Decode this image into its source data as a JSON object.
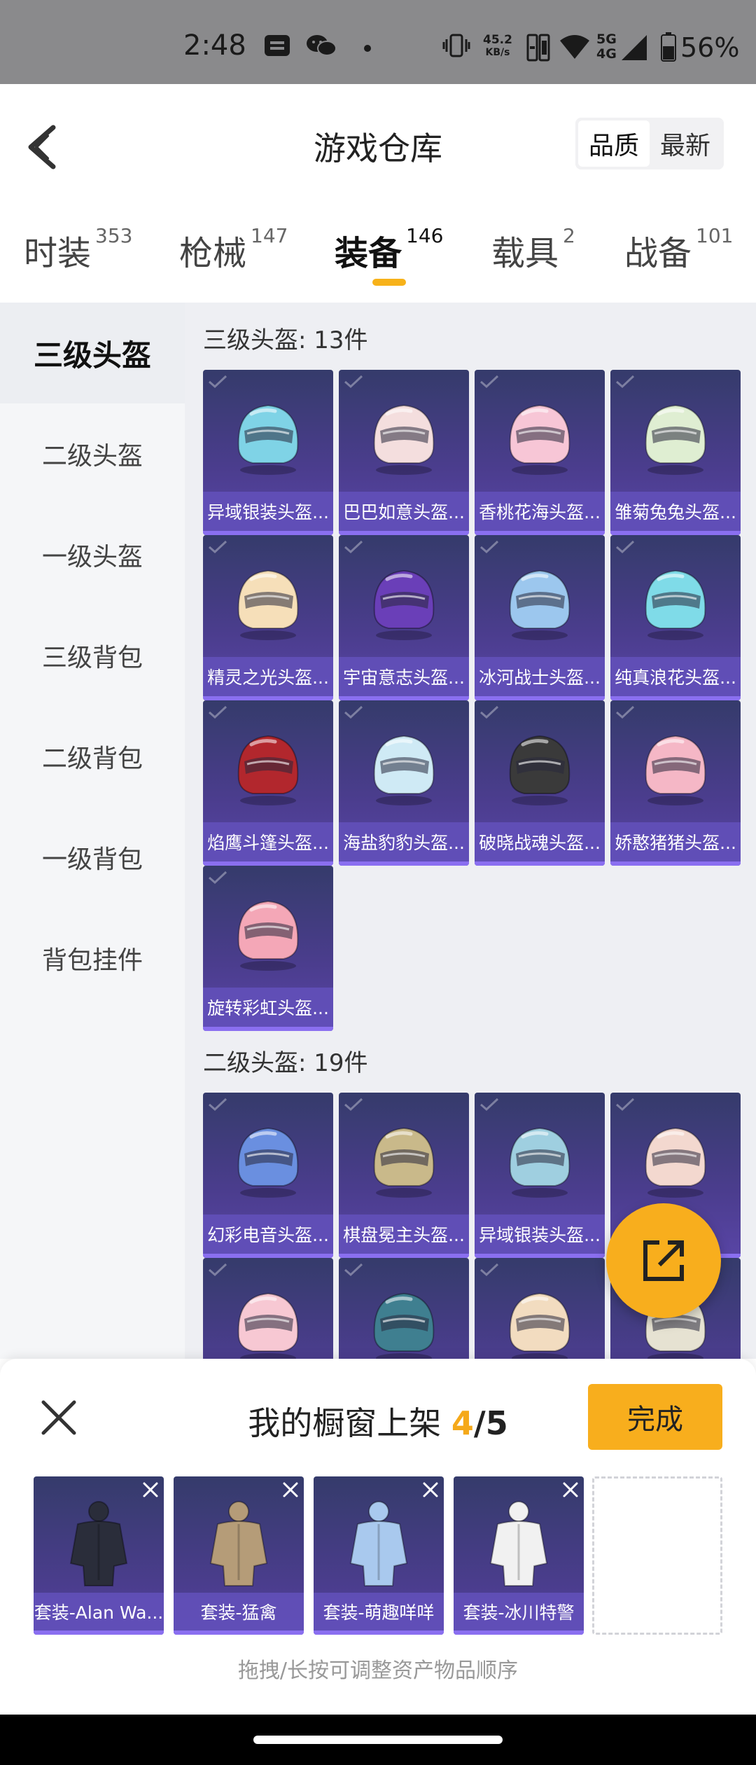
{
  "status_bar": {
    "time": "2:48",
    "net_speed": "45.2",
    "net_unit": "KB/s",
    "network_top": "5G",
    "network_bottom": "4G",
    "battery": "56%"
  },
  "header": {
    "title": "游戏仓库",
    "sort_options": [
      "品质",
      "最新"
    ],
    "active_sort": "品质"
  },
  "tabs": [
    {
      "label": "时装",
      "count": "353"
    },
    {
      "label": "枪械",
      "count": "147"
    },
    {
      "label": "装备",
      "count": "146"
    },
    {
      "label": "载具",
      "count": "2"
    },
    {
      "label": "战备",
      "count": "101"
    }
  ],
  "active_tab": "装备",
  "sidebar": {
    "items": [
      "三级头盔",
      "二级头盔",
      "一级头盔",
      "三级背包",
      "二级背包",
      "一级背包",
      "背包挂件"
    ],
    "active": "三级头盔"
  },
  "sections": [
    {
      "title": "三级头盔: 13件",
      "items": [
        {
          "name": "异域银装头盔...",
          "color": "#7fd3e6"
        },
        {
          "name": "巴巴如意头盔...",
          "color": "#f4dede"
        },
        {
          "name": "香桃花海头盔...",
          "color": "#f7c6d6"
        },
        {
          "name": "雏菊兔兔头盔...",
          "color": "#dfeed2"
        },
        {
          "name": "精灵之光头盔...",
          "color": "#f6dfb9"
        },
        {
          "name": "宇宙意志头盔...",
          "color": "#6a3fb8"
        },
        {
          "name": "冰河战士头盔...",
          "color": "#9cc7ee"
        },
        {
          "name": "纯真浪花头盔...",
          "color": "#7fdbe8"
        },
        {
          "name": "焰鹰斗篷头盔...",
          "color": "#b2272d"
        },
        {
          "name": "海盐豹豹头盔...",
          "color": "#cfeaf5"
        },
        {
          "name": "破晓战魂头盔...",
          "color": "#3a3a3a"
        },
        {
          "name": "娇憨猪猪头盔...",
          "color": "#f5b7c6"
        },
        {
          "name": "旋转彩虹头盔...",
          "color": "#f4a7b7"
        }
      ]
    },
    {
      "title": "二级头盔: 19件",
      "items": [
        {
          "name": "幻彩电音头盔...",
          "color": "#6a8fe0"
        },
        {
          "name": "棋盘冕主头盔...",
          "color": "#c9b98a"
        },
        {
          "name": "异域银装头盔...",
          "color": "#9fcfe0"
        },
        {
          "name": "",
          "color": "#f3d8cf"
        },
        {
          "name": "",
          "color": "#f7c8d3"
        },
        {
          "name": "",
          "color": "#3f7f90"
        },
        {
          "name": "",
          "color": "#f2dcc0"
        },
        {
          "name": "",
          "color": "#e6e2d2"
        }
      ]
    }
  ],
  "showcase": {
    "title_prefix": "我的橱窗上架 ",
    "count": "4",
    "total": "/5",
    "done_label": "完成",
    "slots": [
      {
        "name": "套装-Alan Wa...",
        "color": "#2a2d3a"
      },
      {
        "name": "套装-猛禽",
        "color": "#b59c78"
      },
      {
        "name": "套装-萌趣咩咩",
        "color": "#a9c9ee"
      },
      {
        "name": "套装-冰川特警",
        "color": "#f1f1f1"
      }
    ],
    "hint": "拖拽/长按可调整资产物品顺序"
  }
}
